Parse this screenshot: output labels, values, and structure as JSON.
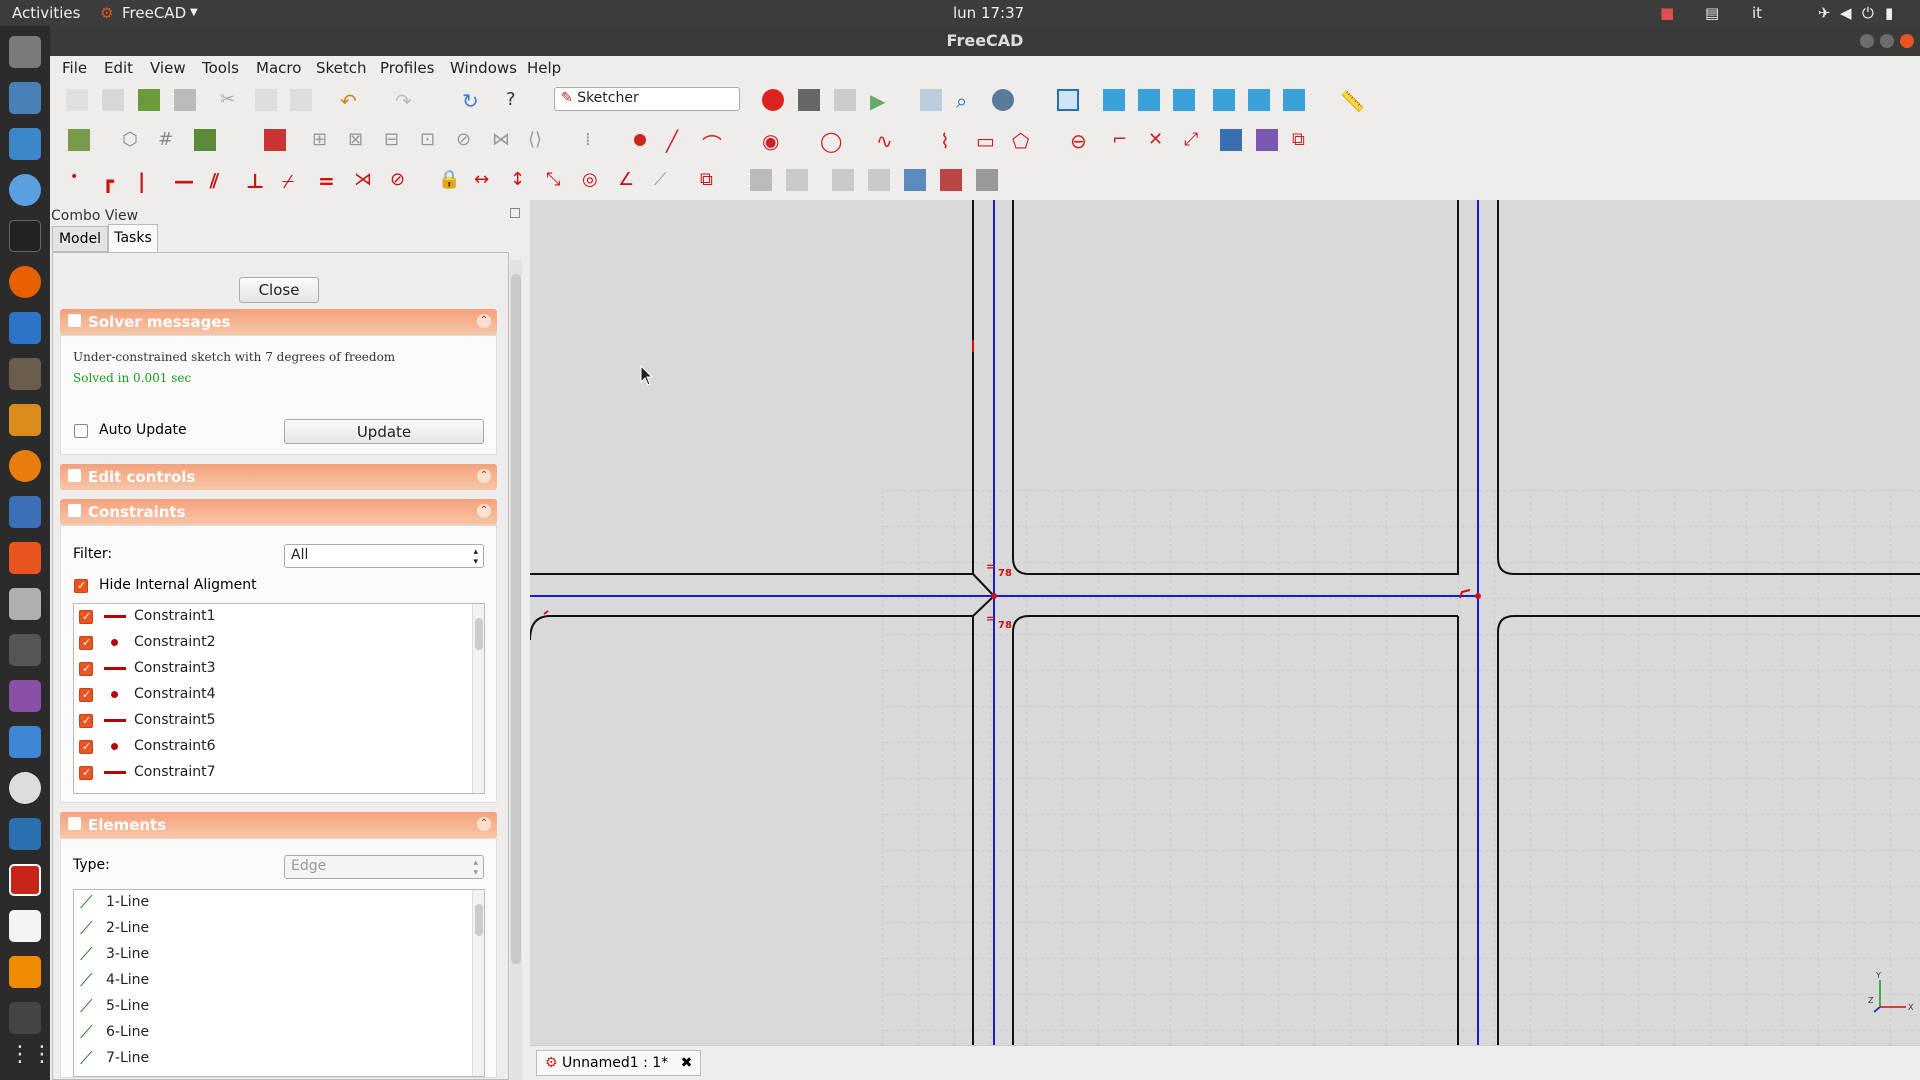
{
  "topbar": {
    "activities": "Activities",
    "app_name": "FreeCAD",
    "clock": "lun 17:37",
    "lang": "it"
  },
  "window": {
    "title": "FreeCAD"
  },
  "menu": [
    "File",
    "Edit",
    "View",
    "Tools",
    "Macro",
    "Sketch",
    "Profiles",
    "Windows",
    "Help"
  ],
  "workbench": {
    "selected": "Sketcher"
  },
  "combo": {
    "title": "Combo View",
    "tabs": [
      "Model",
      "Tasks"
    ],
    "close_label": "Close",
    "solver": {
      "title": "Solver messages",
      "message": "Under-constrained sketch with 7 degrees of freedom",
      "solved": "Solved in 0.001 sec",
      "auto_update": "Auto Update",
      "update_label": "Update"
    },
    "edit_controls": {
      "title": "Edit controls"
    },
    "constraints": {
      "title": "Constraints",
      "filter_label": "Filter:",
      "filter_value": "All",
      "hide_internal": "Hide Internal Aligment",
      "items": [
        "Constraint1",
        "Constraint2",
        "Constraint3",
        "Constraint4",
        "Constraint5",
        "Constraint6",
        "Constraint7"
      ]
    },
    "elements": {
      "title": "Elements",
      "type_label": "Type:",
      "type_value": "Edge",
      "items": [
        "1-Line",
        "2-Line",
        "3-Line",
        "4-Line",
        "5-Line",
        "6-Line",
        "7-Line"
      ]
    }
  },
  "viewport": {
    "dim_label": "78"
  },
  "status": {
    "doc_tab": "Unnamed1 : 1*"
  },
  "colors": {
    "accent": "#e95420",
    "panel_header": "#f4a17c",
    "sketch_blue": "#1a1acc",
    "constraint_red": "#cc1111"
  }
}
